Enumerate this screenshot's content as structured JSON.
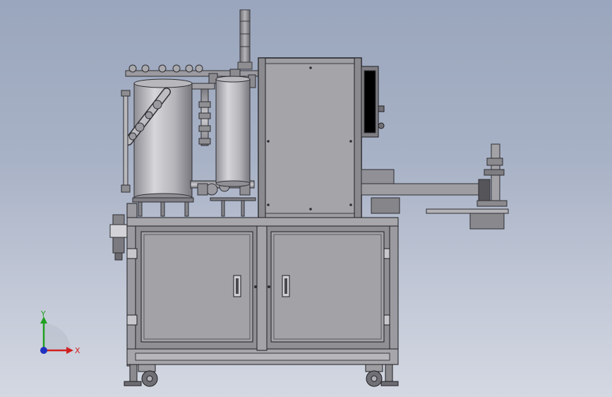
{
  "viewport": {
    "kind": "cad-3d-model-view",
    "background_top": "#9aa6bd",
    "background_bottom": "#d3d8e2"
  },
  "triad": {
    "axis_x_label": "X",
    "axis_y_label": "Y",
    "axis_x_color": "#d02020",
    "axis_y_color": "#20a020",
    "axis_z_color": "#2030c0"
  },
  "model": {
    "icons": [
      "cabinet-door-handle-icon",
      "caster-wheel-icon",
      "signal-tower-icon",
      "filter-regulator-icon"
    ]
  }
}
